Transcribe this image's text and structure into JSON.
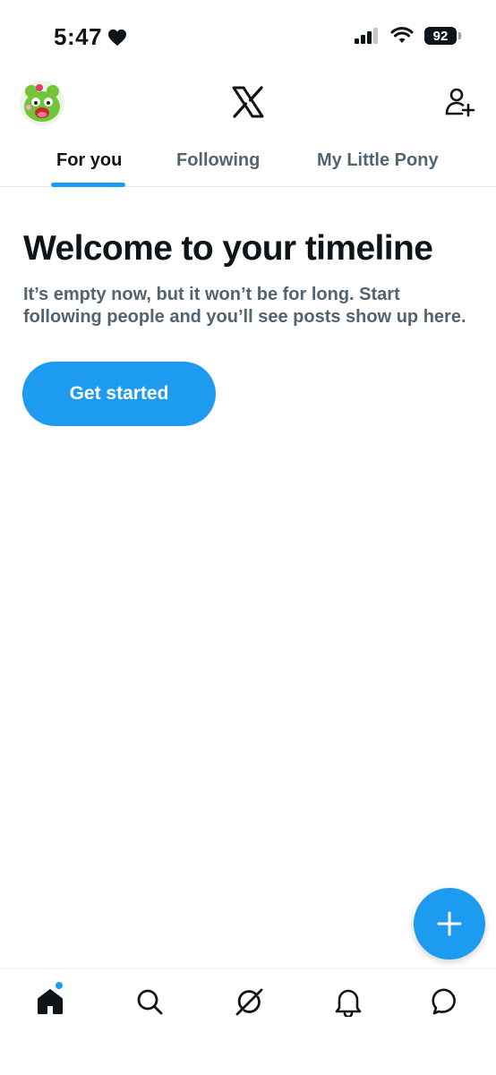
{
  "status_bar": {
    "time": "5:47",
    "battery": "92"
  },
  "header": {
    "logo_icon": "x-logo-icon",
    "avatar_icon": "avatar-icon",
    "follow_icon": "add-user-icon"
  },
  "tabs": [
    {
      "label": "For you",
      "active": true
    },
    {
      "label": "Following",
      "active": false
    },
    {
      "label": "My Little Pony",
      "active": false
    }
  ],
  "main": {
    "title": "Welcome to your timeline",
    "subtitle": "It’s empty now, but it won’t be for long. Start following people and you’ll see posts show up here.",
    "cta_label": "Get started"
  },
  "fab": {
    "icon": "plus-icon"
  },
  "bottom_nav": [
    {
      "name": "home",
      "icon": "home-icon",
      "active": true,
      "badge": true
    },
    {
      "name": "search",
      "icon": "search-icon"
    },
    {
      "name": "grok",
      "icon": "grok-icon"
    },
    {
      "name": "notifications",
      "icon": "bell-icon"
    },
    {
      "name": "messages",
      "icon": "message-icon"
    }
  ],
  "colors": {
    "accent": "#1d9bf0",
    "text": "#0f1419",
    "muted": "#536471"
  }
}
